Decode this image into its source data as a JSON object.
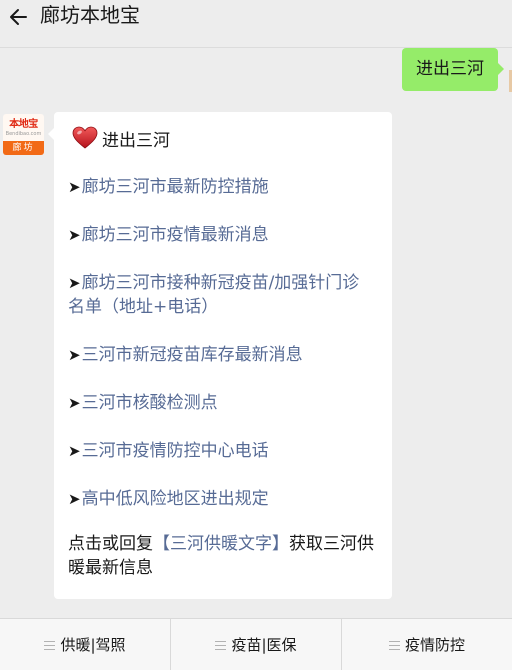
{
  "header": {
    "title": "廊坊本地宝",
    "back_icon": "back-arrow-icon"
  },
  "user_message": {
    "text": "进出三河",
    "bubble_color": "#95ec69"
  },
  "bot_avatar": {
    "brand": "本地宝",
    "url": "Bendibao.com",
    "city": "廊坊",
    "accent": "#f26a16"
  },
  "bot_message": {
    "heart_icon": "heart-icon",
    "title": "进出三河",
    "arrow": "➤",
    "links": [
      {
        "label": "廊坊三河市最新防控措施"
      },
      {
        "label": "廊坊三河市疫情最新消息"
      },
      {
        "label": "廊坊三河市接种新冠疫苗/加强针门诊名单（地址+电话）"
      },
      {
        "label": "三河市新冠疫苗库存最新消息"
      },
      {
        "label": "三河市核酸检测点"
      },
      {
        "label": "三河市疫情防控中心电话"
      },
      {
        "label": "高中低风险地区进出规定"
      }
    ],
    "footer": {
      "prefix": "点击或回复",
      "link": "【三河供暖文字】",
      "suffix": "获取三河供暖最新信息"
    },
    "link_color": "#576b95"
  },
  "bottom_menu": {
    "items": [
      {
        "label": "供暖|驾照"
      },
      {
        "label": "疫苗|医保"
      },
      {
        "label": "疫情防控"
      }
    ]
  }
}
